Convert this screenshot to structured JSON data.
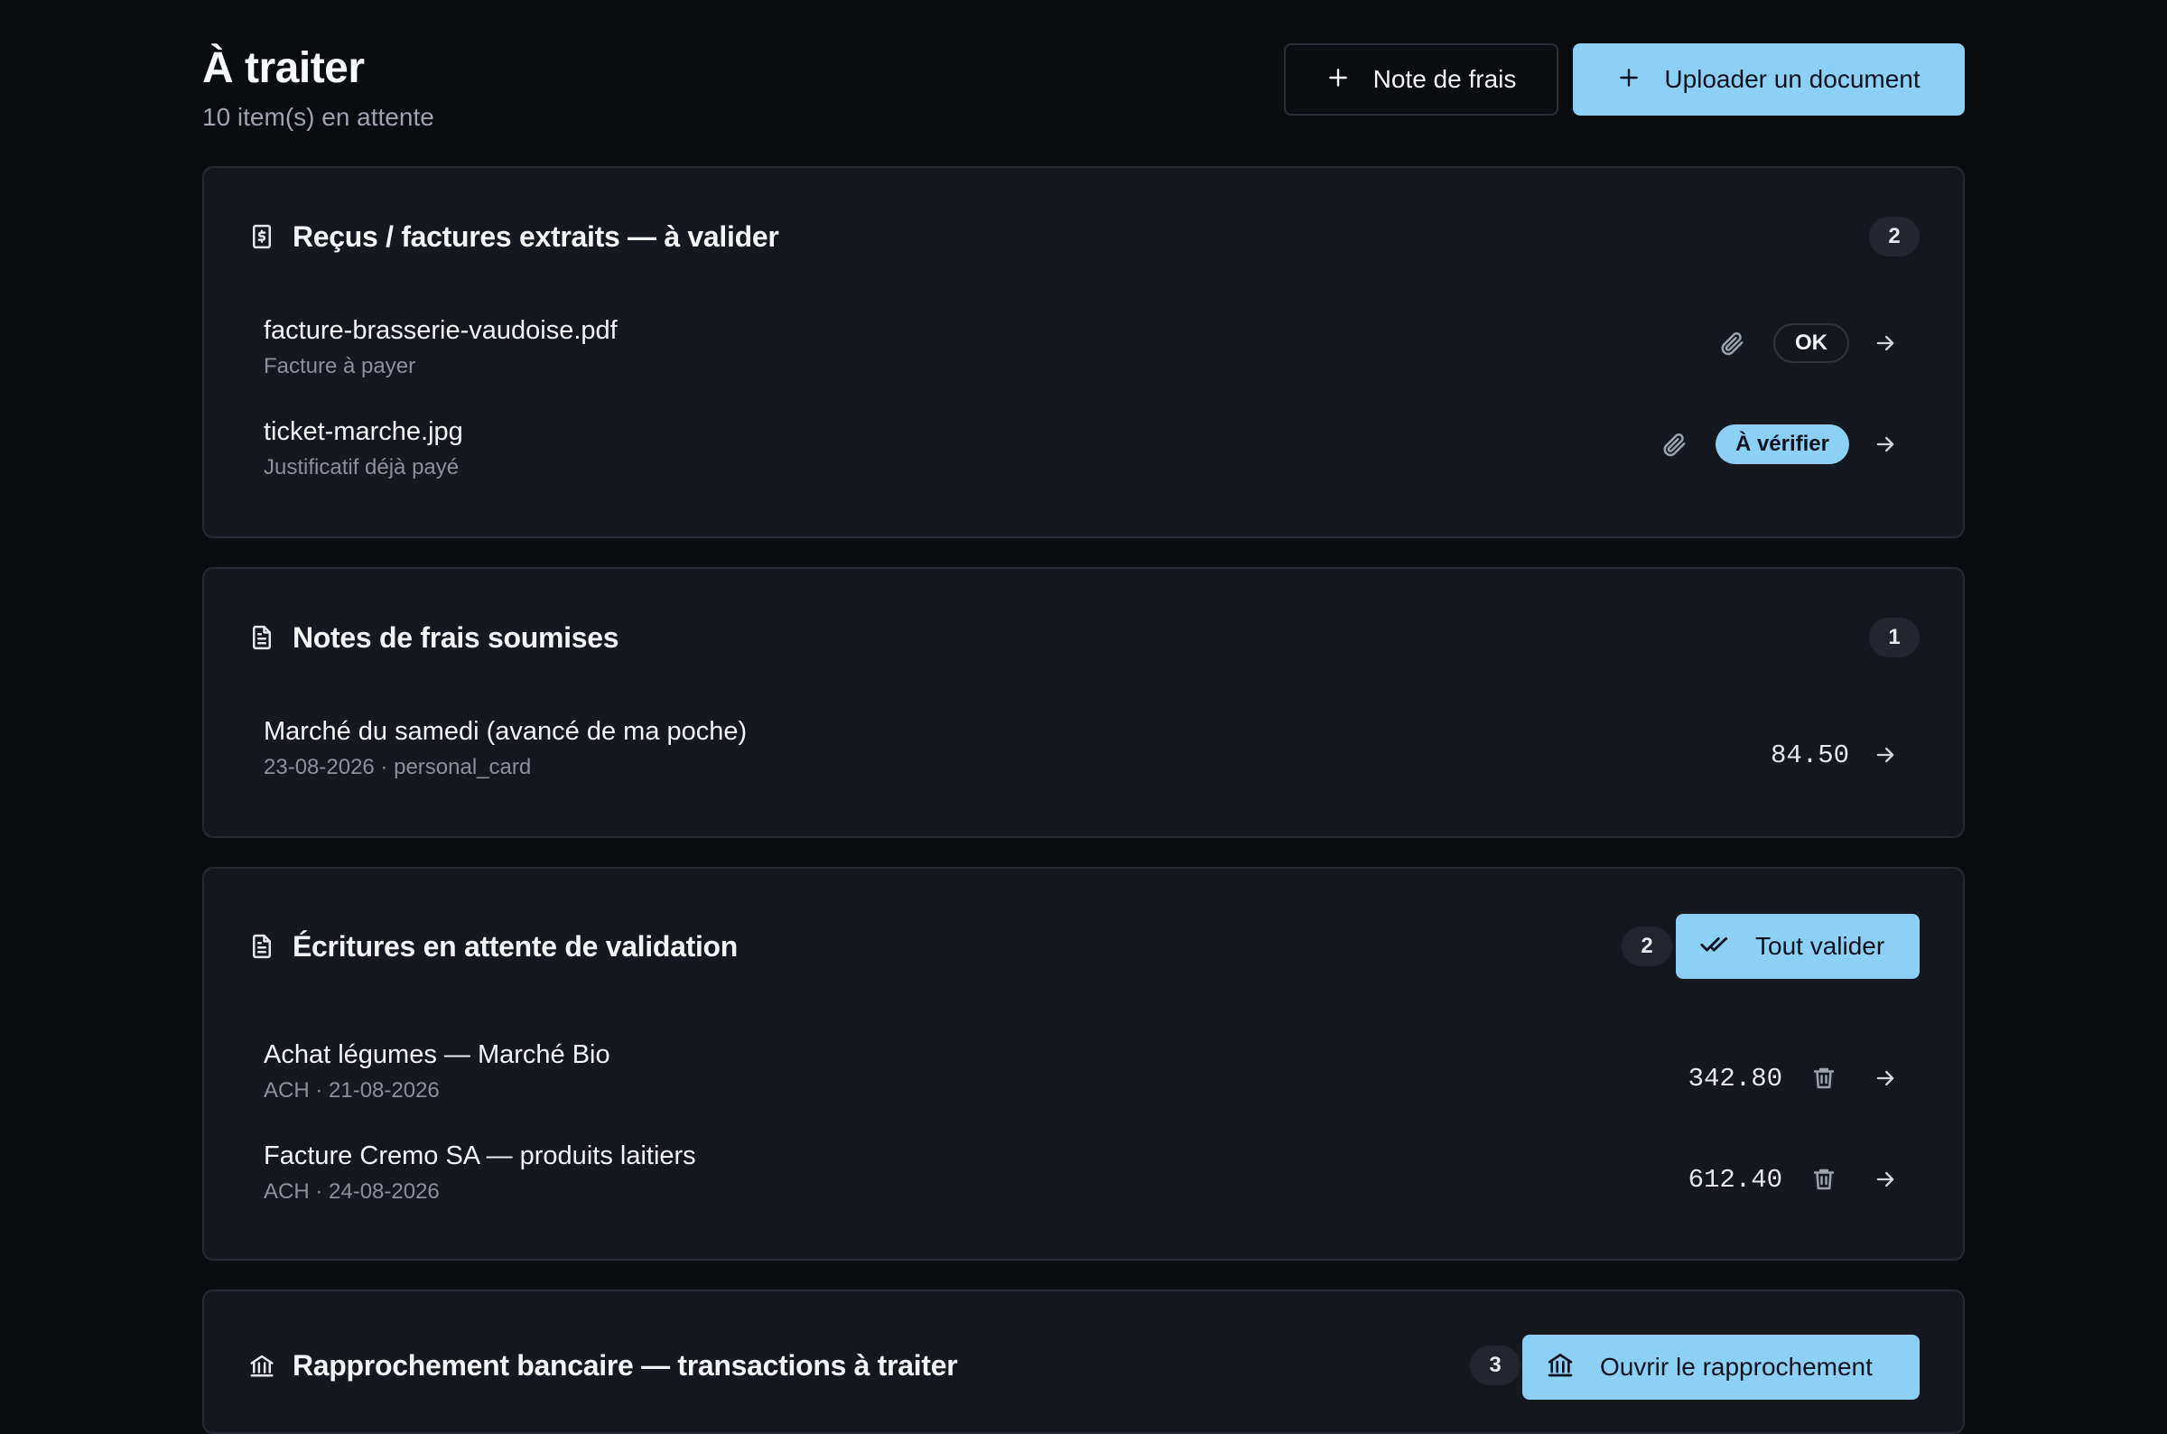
{
  "header": {
    "title": "À traiter",
    "subtitle": "10 item(s) en attente",
    "note_button": "Note de frais",
    "upload_button": "Uploader un document"
  },
  "colors": {
    "accent": "#8dd0f6",
    "background": "#0b0c10",
    "card": "#16181f"
  },
  "sections": {
    "receipts": {
      "title": "Reçus / factures extraits — à valider",
      "icon": "receipt-icon",
      "count": "2",
      "items": [
        {
          "name": "facture-brasserie-vaudoise.pdf",
          "subtitle": "Facture à payer",
          "status": "OK"
        },
        {
          "name": "ticket-marche.jpg",
          "subtitle": "Justificatif déjà payé",
          "status": "À vérifier"
        }
      ]
    },
    "expenses": {
      "title": "Notes de frais soumises",
      "icon": "document-icon",
      "count": "1",
      "items": [
        {
          "name": "Marché du samedi (avancé de ma poche)",
          "subtitle": "23-08-2026 · personal_card",
          "amount": "84.50"
        }
      ]
    },
    "entries": {
      "title": "Écritures en attente de validation",
      "icon": "document-icon",
      "count": "2",
      "action": "Tout valider",
      "items": [
        {
          "name": "Achat légumes — Marché Bio",
          "subtitle": "ACH · 21-08-2026",
          "amount": "342.80"
        },
        {
          "name": "Facture Cremo SA — produits laitiers",
          "subtitle": "ACH · 24-08-2026",
          "amount": "612.40"
        }
      ]
    },
    "bank": {
      "title": "Rapprochement bancaire — transactions à traiter",
      "icon": "bank-icon",
      "count": "3",
      "action": "Ouvrir le rapprochement"
    }
  }
}
